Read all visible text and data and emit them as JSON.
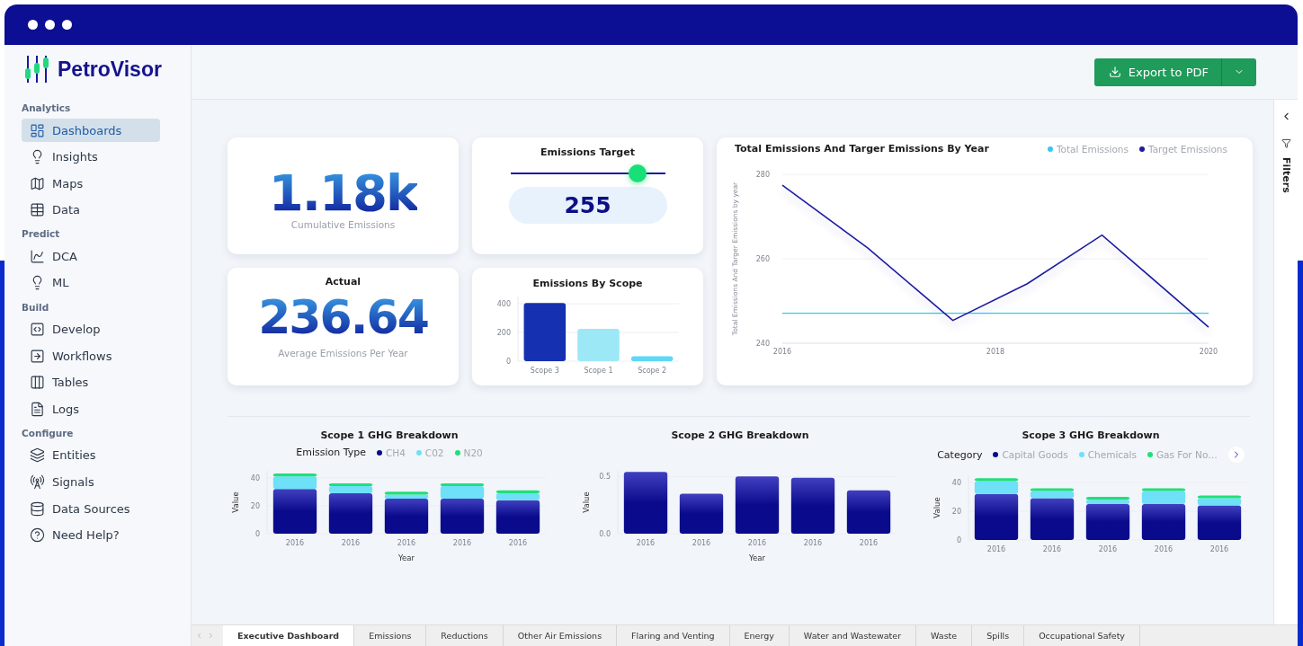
{
  "brand": {
    "name": "PetroVisor"
  },
  "sidebar": {
    "sections": [
      {
        "title": "Analytics",
        "items": [
          {
            "label": "Dashboards",
            "selected": true
          },
          {
            "label": "Insights",
            "selected": false
          },
          {
            "label": "Maps",
            "selected": false
          },
          {
            "label": "Data",
            "selected": false
          }
        ]
      },
      {
        "title": "Predict",
        "items": [
          {
            "label": "DCA",
            "selected": false
          },
          {
            "label": "ML",
            "selected": false
          }
        ]
      },
      {
        "title": "Build",
        "items": [
          {
            "label": "Develop",
            "selected": false
          },
          {
            "label": "Workflows",
            "selected": false
          },
          {
            "label": "Tables",
            "selected": false
          },
          {
            "label": "Logs",
            "selected": false
          }
        ]
      },
      {
        "title": "Configure",
        "items": [
          {
            "label": "Entities",
            "selected": false
          },
          {
            "label": "Signals",
            "selected": false
          },
          {
            "label": "Data Sources",
            "selected": false
          },
          {
            "label": "Need Help?",
            "selected": false
          }
        ]
      }
    ]
  },
  "header": {
    "export_button": "Export to PDF"
  },
  "filters": {
    "label": "Filters"
  },
  "cumulative": {
    "value": "1.18k",
    "label": "Cumulative Emissions"
  },
  "target": {
    "title": "Emissions Target",
    "level": 0.82,
    "value": "255"
  },
  "actual": {
    "title": "Actual",
    "value": "236.64",
    "label": "Average Emissions Per Year"
  },
  "scope_chart": {
    "title": "Emissions By Scope",
    "chart_data": {
      "type": "bar",
      "categories": [
        "Scope 3",
        "Scope 1",
        "Scope 2"
      ],
      "values": [
        405,
        225,
        35
      ],
      "ylim": [
        0,
        450
      ],
      "yticks": [
        0,
        200,
        400
      ]
    }
  },
  "line_chart": {
    "title": "Total Emissions And Targer Emissions By Year",
    "chart_data": {
      "type": "line",
      "ylabel": "Total Emissions And Targer Emissions by year",
      "x": [
        2016,
        2016.8,
        2017.6,
        2018.3,
        2019,
        2020
      ],
      "xlim": [
        2016,
        2020
      ],
      "ylim": [
        240,
        280
      ],
      "xticks": [
        2016,
        2018,
        2020
      ],
      "yticks": [
        240,
        260,
        280
      ],
      "series": [
        {
          "name": "Total Emissions",
          "color": "#36c8f0",
          "values": [
            247.1,
            247.1,
            247.1,
            247.1,
            247.1,
            247.1
          ]
        },
        {
          "name": "Target Emissions",
          "color": "#1d1ba0",
          "values": [
            277.4,
            262.6,
            245.4,
            254.1,
            265.6,
            243.8
          ]
        }
      ]
    }
  },
  "breakdowns": [
    {
      "title": "Scope 1 GHG Breakdown",
      "legend_title": "Emission Type",
      "more": false,
      "chart_data": {
        "type": "bar",
        "stacked": true,
        "xlabel": "Year",
        "ylabel": "Value",
        "categories": [
          "2016",
          "2016",
          "2016",
          "2016",
          "2016"
        ],
        "ylim": [
          0,
          45
        ],
        "yticks": [
          0,
          20,
          40
        ],
        "series": [
          {
            "name": "CH4",
            "color": "#0a0a8c",
            "values": [
              32,
              29,
              25,
              25,
              24
            ]
          },
          {
            "name": "C02",
            "color": "#6ee0f8",
            "values": [
              9,
              5,
              3,
              9,
              5
            ]
          },
          {
            "name": "N20",
            "color": "#1ee07a",
            "values": [
              2,
              2,
              2,
              2,
              2
            ]
          }
        ]
      }
    },
    {
      "title": "Scope 2 GHG Breakdown",
      "chart_data": {
        "type": "bar",
        "xlabel": "Year",
        "ylabel": "Value",
        "categories": [
          "2016",
          "2016",
          "2016",
          "2016",
          "2016"
        ],
        "ylim": [
          0,
          0.55
        ],
        "yticks": [
          {
            "value": 0,
            "label": "0.0"
          },
          {
            "value": 0.5,
            "label": "0.5"
          }
        ],
        "values": [
          0.54,
          0.35,
          0.5,
          0.49,
          0.38
        ]
      }
    },
    {
      "title": "Scope 3 GHG Breakdown",
      "legend_title": "Category",
      "more": true,
      "chart_data": {
        "type": "bar",
        "stacked": true,
        "ylabel": "Value",
        "categories": [
          "2016",
          "2016",
          "2016",
          "2016",
          "2016"
        ],
        "ylim": [
          0,
          45
        ],
        "yticks": [
          0,
          20,
          40
        ],
        "series": [
          {
            "name": "Capital Goods",
            "color": "#0a0a8c",
            "values": [
              32,
              29,
              25,
              25,
              24
            ]
          },
          {
            "name": "Chemicals",
            "color": "#6ee0f8",
            "values": [
              9,
              5,
              3,
              9,
              5
            ]
          },
          {
            "name": "Gas For No…",
            "color": "#1ee07a",
            "values": [
              2,
              2,
              2,
              2,
              2
            ]
          }
        ]
      }
    }
  ],
  "tabs": [
    {
      "label": "Executive Dashboard",
      "selected": true
    },
    {
      "label": "Emissions",
      "selected": false
    },
    {
      "label": "Reductions",
      "selected": false
    },
    {
      "label": "Other Air Emissions",
      "selected": false
    },
    {
      "label": "Flaring and Venting",
      "selected": false
    },
    {
      "label": "Energy",
      "selected": false
    },
    {
      "label": "Water and Wastewater",
      "selected": false
    },
    {
      "label": "Waste",
      "selected": false
    },
    {
      "label": "Spills",
      "selected": false
    },
    {
      "label": "Occupational Safety",
      "selected": false
    }
  ]
}
